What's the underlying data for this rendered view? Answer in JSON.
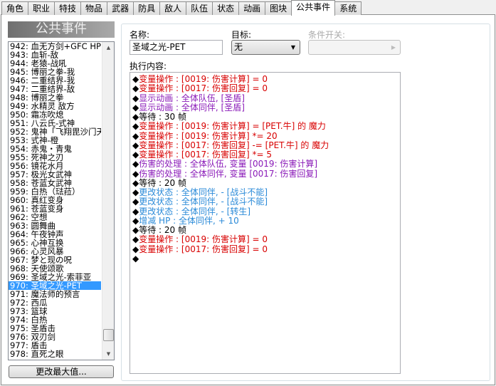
{
  "tabs": [
    "角色",
    "职业",
    "特技",
    "物品",
    "武器",
    "防具",
    "敌人",
    "队伍",
    "状态",
    "动画",
    "图块",
    "公共事件",
    "系统"
  ],
  "active_tab": "公共事件",
  "left_title": "公共事件",
  "list": [
    "942: 血无方剑+GFC HP",
    "943: 血斩-敌",
    "944: 老猿-战吼",
    "945: 博丽之拳-我",
    "946: 二重结界-我",
    "947: 二重结界-敌",
    "948: 博丽之拳",
    "949: 水精灵 敌方",
    "950: 霜冻吹熄",
    "951: 八云氏-式神",
    "952: 鬼神「飞翔毘沙门天」",
    "953: 式神-橙",
    "954: 赤鬼・青鬼",
    "955: 死神之刃",
    "956: 镜花水月",
    "957: 极光女武神",
    "958: 苍蓝女武神",
    "959: 白热（琺菈）",
    "960: 真红变身",
    "961: 苍蓝变身",
    "962: 空想",
    "963: 圆舞曲",
    "964: 午夜钟声",
    "965: 心神互换",
    "966: 心灵风暴",
    "967: 梦と现の呪",
    "968: 天使颂歌",
    "969: 圣域之光-索菲亚",
    "970: 圣域之光-PET",
    "971: 魔法师的预言",
    "972: 西瓜",
    "973: 篮球",
    "974: 白热",
    "975: 圣盾击",
    "976: 双刃剑",
    "977: 盾击",
    "978: 直死之眼"
  ],
  "selected_index": 28,
  "change_max_label": "更改最大值...",
  "form": {
    "name_label": "名称:",
    "name_value": "圣域之光-PET",
    "target_label": "目标:",
    "target_value": "无",
    "switch_label": "条件开关:",
    "switch_value": "",
    "contents_label": "执行内容:"
  },
  "colors": {
    "var": "#d80000",
    "anim": "#8a1ab8",
    "state": "#2a8ad8",
    "wait": "#000000",
    "selection": "#3399ff"
  },
  "commands": [
    {
      "text": "变量操作 : [0019: 伤害计算] = 0",
      "type": "var"
    },
    {
      "text": "变量操作 : [0017: 伤害回复] = 0",
      "type": "var"
    },
    {
      "text": "显示动画 : 全体队伍, [圣盾]",
      "type": "anim"
    },
    {
      "text": "显示动画 : 全体同伴, [圣盾]",
      "type": "anim"
    },
    {
      "text": "等待 : 30 帧",
      "type": "wait"
    },
    {
      "text": "变量操作 : [0019: 伤害计算] = [PET.牛] 的 魔力",
      "type": "var"
    },
    {
      "text": "变量操作 : [0019: 伤害计算] *= 20",
      "type": "var"
    },
    {
      "text": "变量操作 : [0017: 伤害回复] -= [PET.牛] 的 魔力",
      "type": "var"
    },
    {
      "text": "变量操作 : [0017: 伤害回复] *= 5",
      "type": "var"
    },
    {
      "text": "伤害的处理 : 全体队伍, 变量 [0019: 伤害计算]",
      "type": "anim"
    },
    {
      "text": "伤害的处理 : 全体同伴, 变量 [0017: 伤害回复]",
      "type": "anim"
    },
    {
      "text": "等待 : 20 帧",
      "type": "wait"
    },
    {
      "text": "更改状态 : 全体同伴, - [战斗不能]",
      "type": "state"
    },
    {
      "text": "更改状态 : 全体同伴, - [战斗不能]",
      "type": "state"
    },
    {
      "text": "更改状态 : 全体同伴, - [转生]",
      "type": "state"
    },
    {
      "text": "增减 HP : 全体同伴, + 10",
      "type": "state"
    },
    {
      "text": "等待 : 20 帧",
      "type": "wait"
    },
    {
      "text": "变量操作 : [0019: 伤害计算] = 0",
      "type": "var"
    },
    {
      "text": "变量操作 : [0017: 伤害回复] = 0",
      "type": "var"
    },
    {
      "text": "",
      "type": "wait"
    }
  ]
}
